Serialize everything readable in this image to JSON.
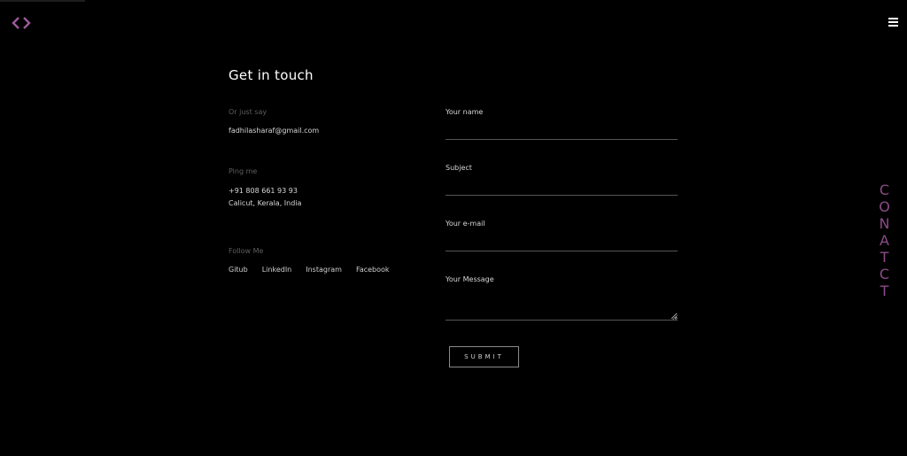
{
  "header": {
    "logo_icon": "code-brackets-icon",
    "menu_icon": "hamburger-icon",
    "accent_color": "#9b5a97"
  },
  "contact": {
    "title": "Get in touch",
    "email_label": "Or just say",
    "email": "fadhilasharaf@gmail.com",
    "phone_label": "Ping me",
    "phone": "+91 808 661 93 93",
    "location": "Calicut, Kerala, India",
    "follow_label": "Follow Me",
    "social": [
      "Gitub",
      "LinkedIn",
      "Instagram",
      "Facebook"
    ]
  },
  "form": {
    "name_label": "Your name",
    "subject_label": "Subject",
    "email_label": "Your e-mail",
    "message_label": "Your Message",
    "submit_label": "SUBMIT"
  },
  "section_label": "CONATCT"
}
